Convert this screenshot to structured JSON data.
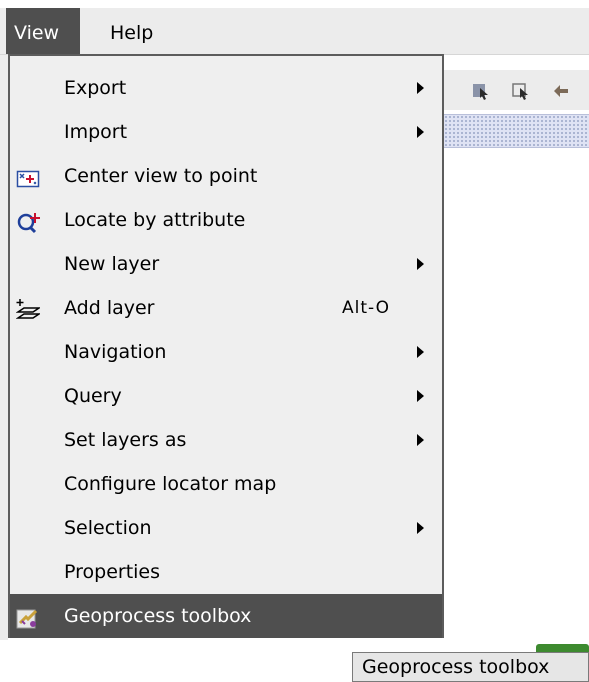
{
  "menubar": {
    "items": [
      {
        "label": "View"
      },
      {
        "label": "Help"
      }
    ]
  },
  "view_menu": {
    "items": [
      {
        "label": "Export",
        "submenu": true,
        "icon": null
      },
      {
        "label": "Import",
        "submenu": true,
        "icon": null
      },
      {
        "label": "Center view to point",
        "submenu": false,
        "icon": "center-point-icon"
      },
      {
        "label": "Locate by attribute",
        "submenu": false,
        "icon": "locate-attribute-icon"
      },
      {
        "label": "New layer",
        "submenu": true,
        "icon": null
      },
      {
        "label": "Add layer",
        "shortcut": "Alt-O",
        "submenu": false,
        "icon": "add-layer-icon"
      },
      {
        "label": "Navigation",
        "submenu": true,
        "icon": null
      },
      {
        "label": "Query",
        "submenu": true,
        "icon": null
      },
      {
        "label": "Set layers as",
        "submenu": true,
        "icon": null
      },
      {
        "label": "Configure locator map",
        "submenu": false,
        "icon": null
      },
      {
        "label": "Selection",
        "submenu": true,
        "icon": null
      },
      {
        "label": "Properties",
        "submenu": false,
        "icon": null
      },
      {
        "label": "Geoprocess toolbox",
        "submenu": false,
        "icon": "geoprocess-icon",
        "selected": true
      }
    ]
  },
  "tooltip": {
    "text": "Geoprocess toolbox"
  },
  "colors": {
    "menu_bg": "#efefef",
    "highlight": "#4f4f4f",
    "highlight_text": "#ffffff"
  }
}
